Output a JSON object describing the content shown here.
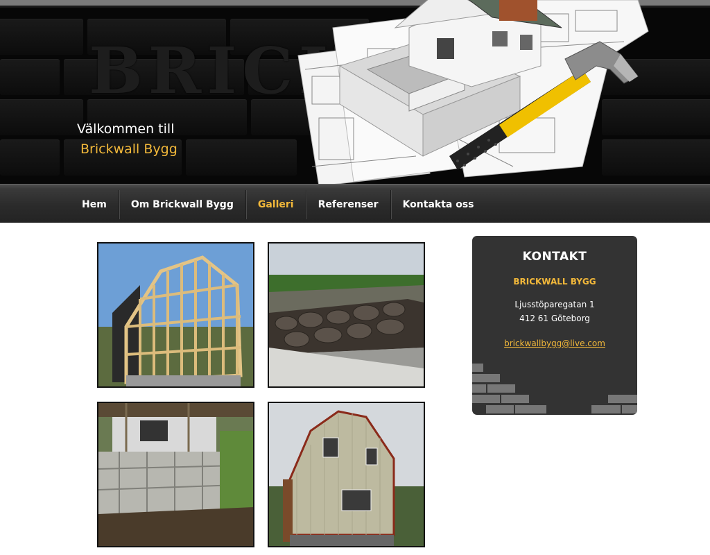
{
  "header": {
    "background_word": "BRICK",
    "welcome_line": "Välkommen till",
    "company_line": "Brickwall Bygg"
  },
  "nav": {
    "items": [
      {
        "label": "Hem"
      },
      {
        "label": "Om Brickwall Bygg"
      },
      {
        "label": "Galleri",
        "active": true
      },
      {
        "label": "Referenser"
      },
      {
        "label": "Kontakta oss"
      }
    ]
  },
  "contact": {
    "title": "KONTAKT",
    "company": "BRICKWALL BYGG",
    "street": "Ljusstöparegatan 1",
    "city": "412 61 Göteborg",
    "email": "brickwallbygg@live.com"
  },
  "colors": {
    "accent": "#f2b83a",
    "header_bg": "#070707",
    "contact_bg": "#333333"
  }
}
